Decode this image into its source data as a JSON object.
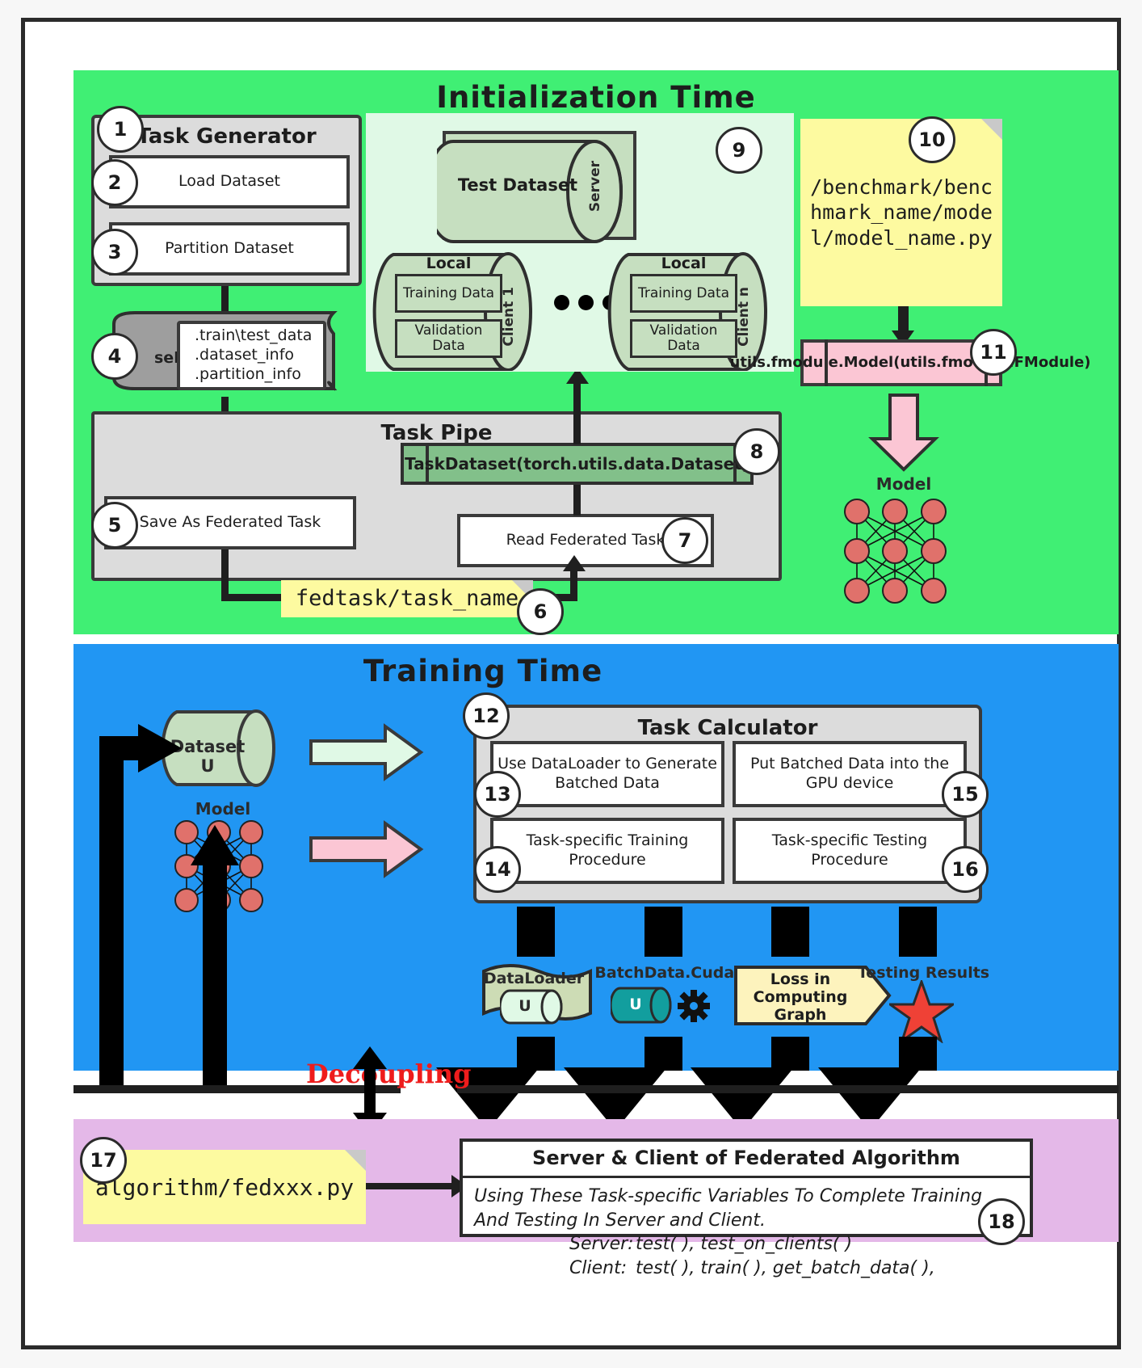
{
  "sections": {
    "init": {
      "title": "Initialization Time",
      "color": "#40ef74"
    },
    "train": {
      "title": "Training Time",
      "color": "#2196f3"
    },
    "algo": {
      "color": "#e4b8e8"
    }
  },
  "task_generator": {
    "title": "Task Generator",
    "badge": "1",
    "items": [
      {
        "badge": "2",
        "label": "Load Dataset"
      },
      {
        "badge": "3",
        "label": "Partition Dataset"
      }
    ]
  },
  "self_doc": {
    "badge": "4",
    "self_label": "self",
    "lines": [
      ".train\\test_data",
      ".dataset_info",
      ".partition_info"
    ]
  },
  "task_pipe": {
    "title": "Task Pipe",
    "save_badge": "5",
    "save_label": "Save As Federated Task",
    "dataset_badge": "8",
    "dataset_label": "TaskDataset(torch.utils.data.Dataset)",
    "read_badge": "7",
    "read_label": "Read Federated Task"
  },
  "fedtask_note": {
    "badge": "6",
    "label": "fedtask/task_name"
  },
  "datasets_panel": {
    "badge": "9",
    "server": {
      "name": "Test Dataset",
      "role": "Server"
    },
    "clients": [
      {
        "title": "Local Dataset",
        "training": "Training Data",
        "validation": "Validation Data",
        "role": "Client 1"
      },
      {
        "title": "Local Dataset",
        "training": "Training Data",
        "validation": "Validation Data",
        "role": "Client n"
      }
    ],
    "ellipsis": "•••"
  },
  "model_note": {
    "badge": "10",
    "text": "/benchmark/benchmark_name/model/model_name.py"
  },
  "fmodule": {
    "badge": "11",
    "text": "utils.fmodule.Model(utils.fmodule.FModule)"
  },
  "model_init": {
    "label": "Model"
  },
  "training": {
    "dataset_u": "Dataset U",
    "model_label": "Model",
    "task_calculator": {
      "badge": "12",
      "title": "Task Calculator",
      "cells": [
        {
          "badge": "13",
          "label": "Use DataLoader to Generate Batched Data"
        },
        {
          "badge": "15",
          "label": "Put Batched Data into the GPU device"
        },
        {
          "badge": "14",
          "label": "Task-specific Training Procedure"
        },
        {
          "badge": "16",
          "label": "Task-specific Testing Procedure"
        }
      ]
    },
    "artifacts": [
      {
        "name": "DataLoader",
        "sub": "U"
      },
      {
        "name": "BatchData.Cuda()",
        "sub": "U"
      },
      {
        "name": "Loss in Computing Graph"
      },
      {
        "name": "Testing Results"
      }
    ]
  },
  "decoupling": {
    "label": "Decoupling"
  },
  "algorithm": {
    "badge": "17",
    "note": "algorithm/fedxxx.py",
    "badge_panel": "18",
    "panel_title": "Server & Client of Federated Algorithm",
    "panel_intro": "Using These Task-specific Variables To Complete Training And Testing In Server and Client.",
    "rows": [
      {
        "key": "Server:",
        "value": "test( ), test_on_clients( )"
      },
      {
        "key": "Client:",
        "value": "test( ), train( ), get_batch_data( ),"
      }
    ]
  },
  "colors": {
    "init_green": "#40ef74",
    "train_blue": "#2196f3",
    "algo_purple": "#e4b8e8",
    "note_yellow": "#fdfaa0",
    "pink": "#fbc6d4",
    "cyl_green": "#c6dfc0",
    "panel_grey": "#dcdcdc",
    "decoupling_red": "#ee1c1c",
    "neuron_red": "#e0716b",
    "star_red": "#ef4136",
    "teal": "#129e9e"
  }
}
